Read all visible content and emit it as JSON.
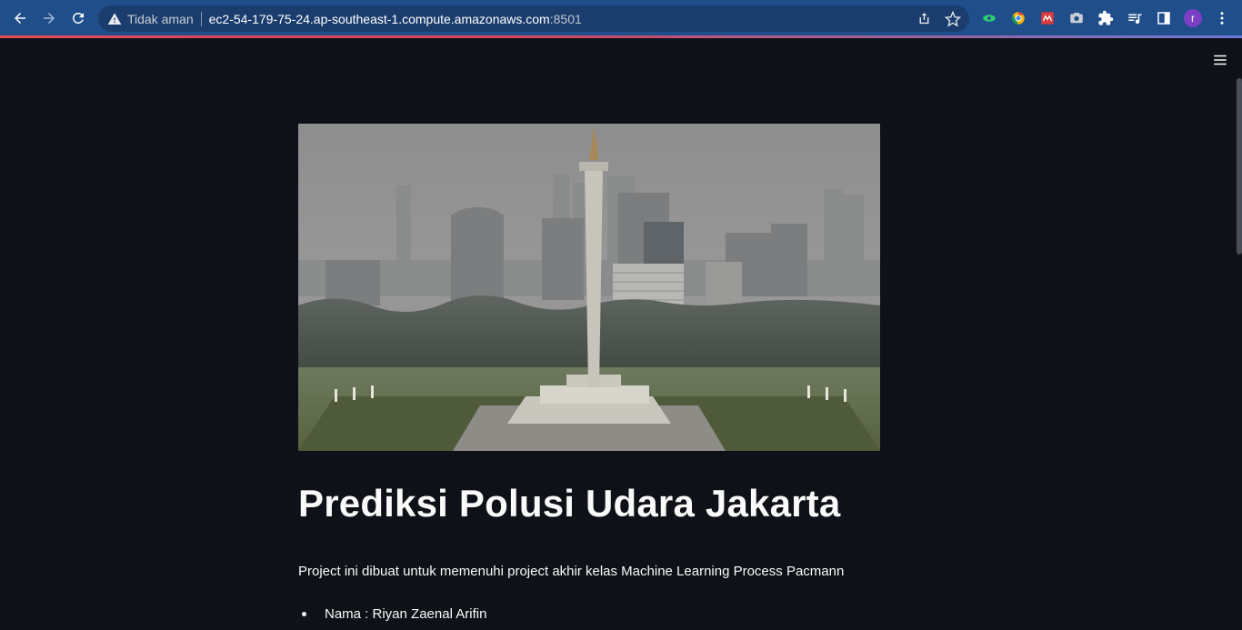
{
  "browser": {
    "security_label": "Tidak aman",
    "url_host": "ec2-54-179-75-24.ap-southeast-1.compute.amazonaws.com",
    "url_port": ":8501",
    "profile_initial": "r",
    "accent_color": "#1f4e8b"
  },
  "app": {
    "title": "Prediksi Polusi Udara Jakarta",
    "description": "Project ini dibuat untuk memenuhi project akhir kelas Machine Learning Process Pacmann",
    "info_items": [
      {
        "label": "Nama : Riyan Zaenal Arifin"
      }
    ],
    "hero_image": "monas-jakarta-hazy-skyline",
    "background_color": "#0e1117",
    "text_color": "#fafafa"
  }
}
